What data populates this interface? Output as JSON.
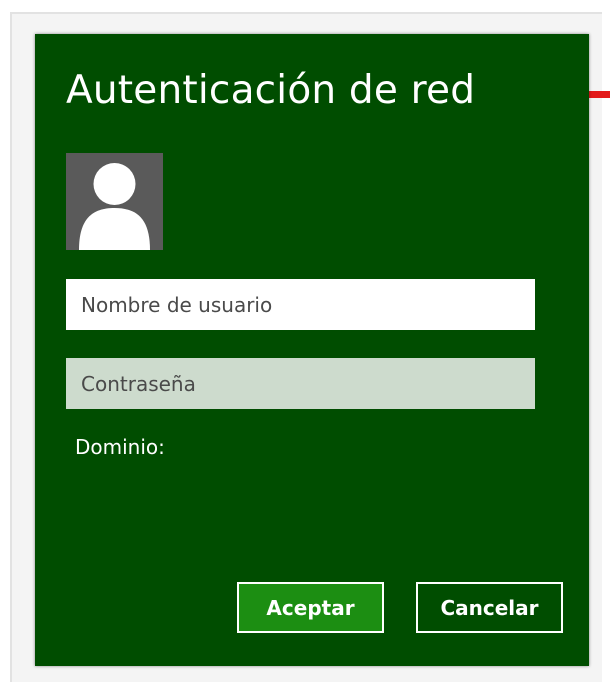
{
  "dialog": {
    "title": "Autenticación de red",
    "avatar_icon": "user-avatar-icon",
    "username": {
      "placeholder": "Nombre de usuario",
      "value": ""
    },
    "password": {
      "placeholder": "Contraseña",
      "value": ""
    },
    "domain_label": "Dominio:",
    "buttons": {
      "accept": "Aceptar",
      "cancel": "Cancelar"
    }
  },
  "colors": {
    "dialog_background": "#004d00",
    "accept_button": "#1c8e12",
    "password_field": "#cddbcd",
    "avatar_background": "#5a5a5a",
    "accent_marker": "#e31a1a"
  }
}
